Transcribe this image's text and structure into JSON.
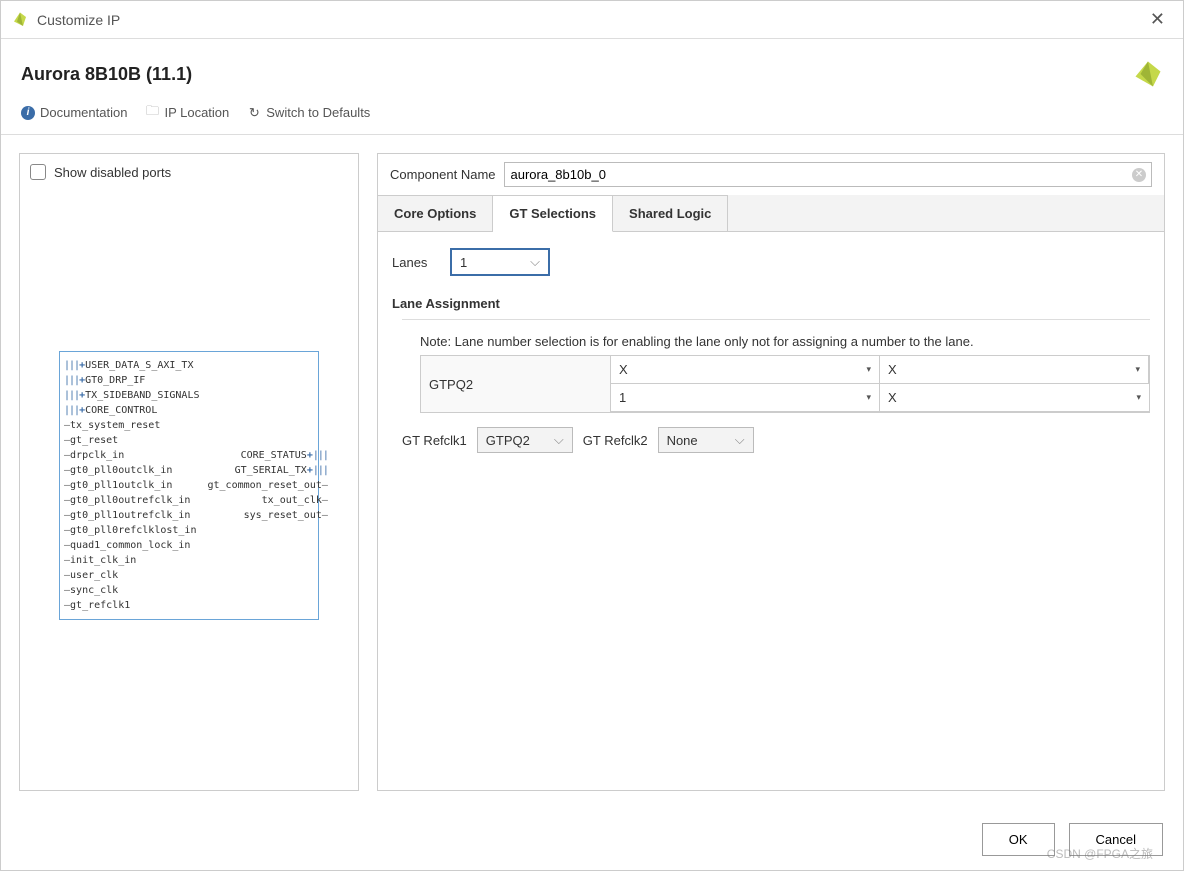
{
  "window": {
    "title": "Customize IP"
  },
  "header": {
    "title": "Aurora 8B10B (11.1)"
  },
  "toolbar": {
    "doc": "Documentation",
    "location": "IP Location",
    "defaults": "Switch to Defaults"
  },
  "left": {
    "show_disabled": "Show disabled ports",
    "ports_left": [
      {
        "name": "USER_DATA_S_AXI_TX",
        "bus": true,
        "plus": true
      },
      {
        "name": "GT0_DRP_IF",
        "bus": true,
        "plus": true
      },
      {
        "name": "TX_SIDEBAND_SIGNALS",
        "bus": true,
        "plus": true
      },
      {
        "name": "CORE_CONTROL",
        "bus": true,
        "plus": true
      },
      {
        "name": "tx_system_reset",
        "bus": false
      },
      {
        "name": "gt_reset",
        "bus": false
      },
      {
        "name": "drpclk_in",
        "bus": false
      },
      {
        "name": "gt0_pll0outclk_in",
        "bus": false
      },
      {
        "name": "gt0_pll1outclk_in",
        "bus": false
      },
      {
        "name": "gt0_pll0outrefclk_in",
        "bus": false
      },
      {
        "name": "gt0_pll1outrefclk_in",
        "bus": false
      },
      {
        "name": "gt0_pll0refclklost_in",
        "bus": false
      },
      {
        "name": "quad1_common_lock_in",
        "bus": false
      },
      {
        "name": "init_clk_in",
        "bus": false
      },
      {
        "name": "user_clk",
        "bus": false
      },
      {
        "name": "sync_clk",
        "bus": false
      },
      {
        "name": "gt_refclk1",
        "bus": false
      }
    ],
    "ports_right": [
      {
        "name": "CORE_STATUS",
        "bus": true,
        "plus": true
      },
      {
        "name": "GT_SERIAL_TX",
        "bus": true,
        "plus": true
      },
      {
        "name": "gt_common_reset_out",
        "bus": false
      },
      {
        "name": "tx_out_clk",
        "bus": false
      },
      {
        "name": "sys_reset_out",
        "bus": false
      }
    ]
  },
  "right": {
    "comp_name_label": "Component Name",
    "comp_name_value": "aurora_8b10b_0",
    "tabs": {
      "core": "Core Options",
      "gt": "GT Selections",
      "shared": "Shared Logic"
    },
    "lanes_label": "Lanes",
    "lanes_value": "1",
    "lane_assign_title": "Lane Assignment",
    "note": "Note: Lane number selection is for enabling the lane only not for assigning a number to the lane.",
    "table": {
      "rowhead": "GTPQ2",
      "cells": [
        [
          "X",
          "X"
        ],
        [
          "1",
          "X"
        ]
      ]
    },
    "refclk1_label": "GT Refclk1",
    "refclk1_value": "GTPQ2",
    "refclk2_label": "GT Refclk2",
    "refclk2_value": "None"
  },
  "footer": {
    "ok": "OK",
    "cancel": "Cancel"
  },
  "watermark": "CSDN @FPGA之旅"
}
